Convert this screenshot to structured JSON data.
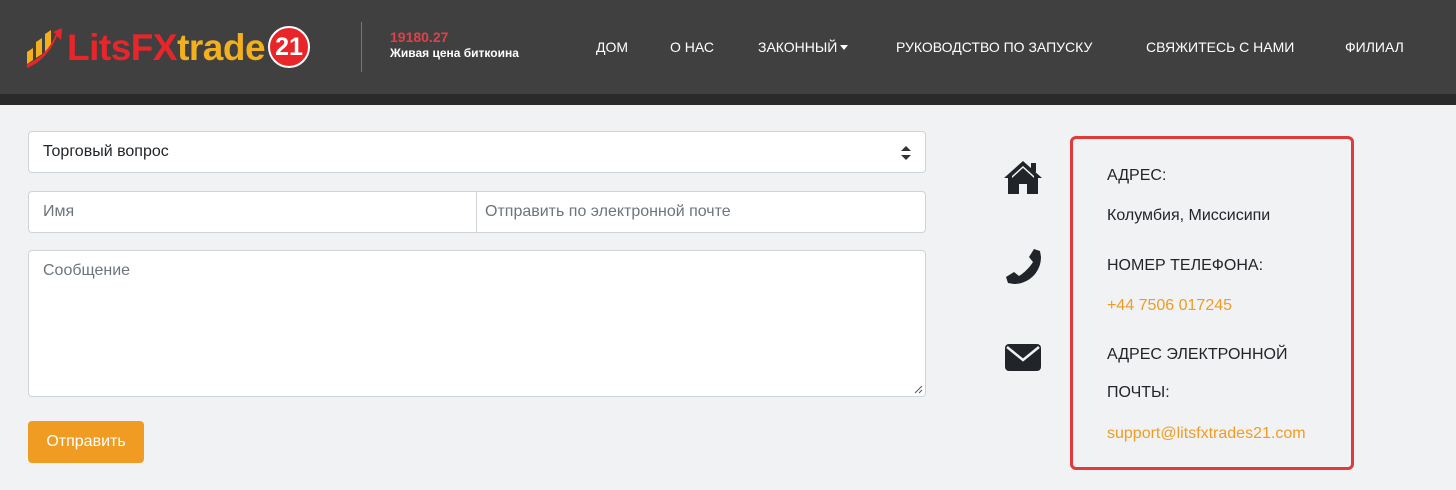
{
  "header": {
    "logo": {
      "part1": "LitsFX",
      "part2": "trade",
      "badge": "21"
    },
    "btc": {
      "price": "19180.27",
      "label": "Живая цена биткоина"
    },
    "nav": [
      {
        "label": "ДОМ"
      },
      {
        "label": "О НАС"
      },
      {
        "label": "ЗАКОННЫЙ"
      },
      {
        "label": "РУКОВОДСТВО ПО ЗАПУСКУ"
      },
      {
        "label": "СВЯЖИТЕСЬ С НАМИ"
      },
      {
        "label": "ФИЛИАЛ"
      }
    ]
  },
  "form": {
    "topic_selected": "Торговый вопрос",
    "name_placeholder": "Имя",
    "email_placeholder": "Отправить по электронной почте",
    "message_placeholder": "Сообщение",
    "submit_label": "Отправить"
  },
  "contact": {
    "address_label": "АДРЕС:",
    "address_value": "Колумбия, Миссисипи",
    "phone_label": "НОМЕР ТЕЛЕФОНА:",
    "phone_value": "+44 7506 017245",
    "email_label_line1": "АДРЕС ЭЛЕКТРОННОЙ",
    "email_label_line2": "ПОЧТЫ:",
    "email_value": "support@litsfxtrades21.com"
  },
  "icons": {
    "address": "home-icon",
    "phone": "phone-icon",
    "email": "envelope-icon"
  },
  "colors": {
    "accent": "#f09c22",
    "header_bg": "#404040",
    "highlight_border": "#e13a3a",
    "btc_price": "#e0404a"
  }
}
